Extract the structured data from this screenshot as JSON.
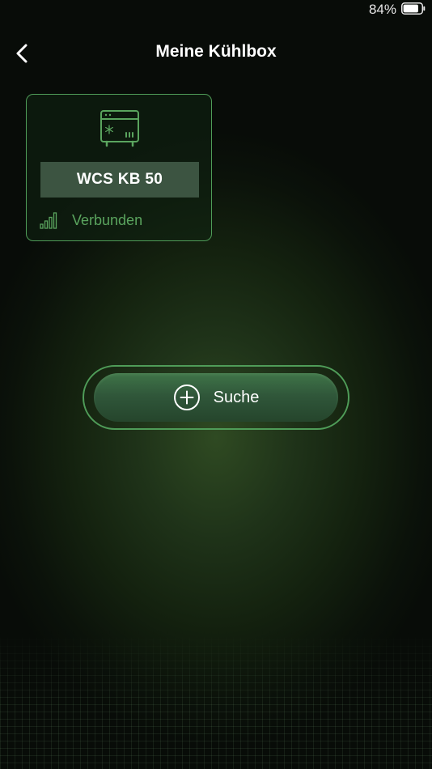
{
  "status_bar": {
    "battery_percent": "84%",
    "battery_level": 0.84
  },
  "header": {
    "title": "Meine Kühlbox",
    "back_icon": "chevron-left-icon"
  },
  "device_card": {
    "icon": "cool-box-icon",
    "name": "WCS KB 50",
    "status_icon": "signal-strength-icon",
    "status": "Verbunden"
  },
  "search_button": {
    "icon": "plus-circle-icon",
    "label": "Suche"
  },
  "colors": {
    "accent": "#4f9c58",
    "status_text": "#5aa45e",
    "card_name_bg": "#3c5441",
    "background": "#14220f"
  }
}
